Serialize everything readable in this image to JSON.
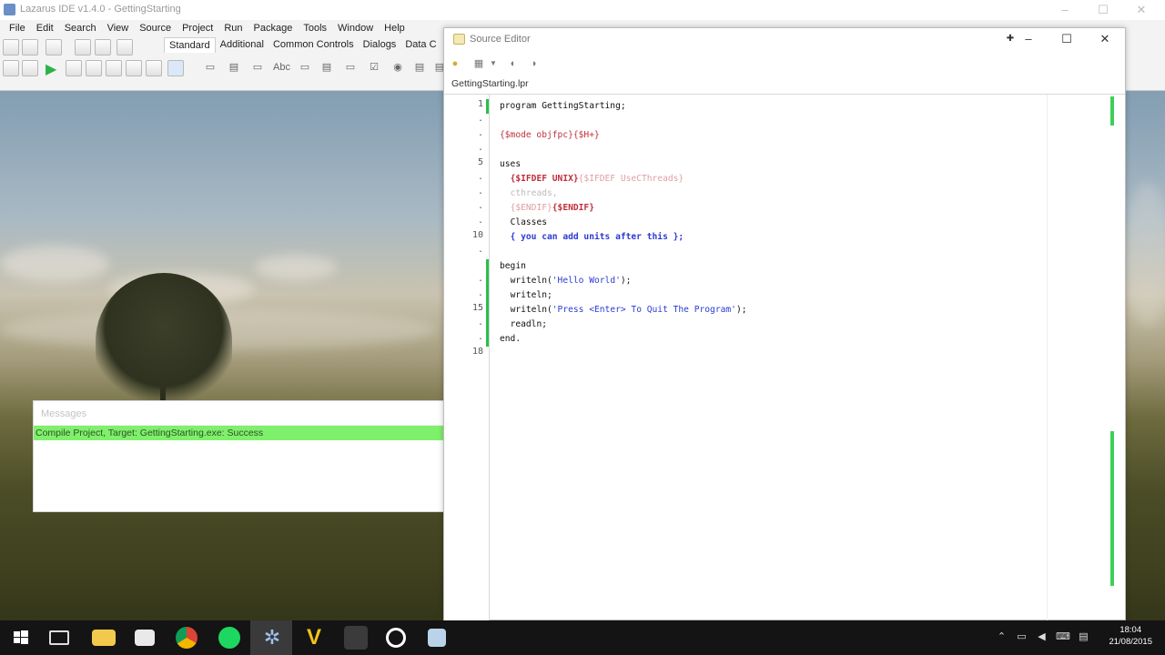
{
  "ide": {
    "title": "Lazarus IDE v1.4.0 - GettingStarting",
    "menu": [
      "File",
      "Edit",
      "Search",
      "View",
      "Source",
      "Project",
      "Run",
      "Package",
      "Tools",
      "Window",
      "Help"
    ],
    "palette_tabs": [
      "Standard",
      "Additional",
      "Common Controls",
      "Dialogs",
      "Data C"
    ]
  },
  "messages": {
    "title": "Messages",
    "row": "Compile Project, Target: GettingStarting.exe: Success"
  },
  "source_editor": {
    "title": "Source Editor",
    "tab": "GettingStarting.lpr",
    "line_numbers": [
      "1",
      ".",
      ".",
      ".",
      "5",
      ".",
      ".",
      ".",
      ".",
      "10",
      ".",
      "",
      ".",
      ".",
      "15",
      ".",
      ".",
      "18"
    ],
    "code": {
      "l1": "program GettingStarting;",
      "l3": "{$mode objfpc}{$H+}",
      "l5": "uses",
      "l6a": "{$IFDEF UNIX}",
      "l6b": "{$IFDEF UseCThreads}",
      "l7": "cthreads,",
      "l8a": "{$ENDIF}",
      "l8b": "{$ENDIF}",
      "l9": "Classes",
      "l10": "{ you can add units after this };",
      "l12": "begin",
      "l13a": "writeln(",
      "l13s": "'Hello World'",
      "l13b": ");",
      "l14": "writeln;",
      "l15a": "writeln(",
      "l15s": "'Press <Enter> To Quit The Program'",
      "l15b": ");",
      "l16": "readln;",
      "l17": "end."
    }
  },
  "taskbar": {
    "time": "18:04",
    "date": "21/08/2015"
  },
  "colors": {
    "success_green": "#7ff06b",
    "directive_red": "#c0303c",
    "comment_blue": "#2c3bd0",
    "taskbar": "#141414"
  }
}
